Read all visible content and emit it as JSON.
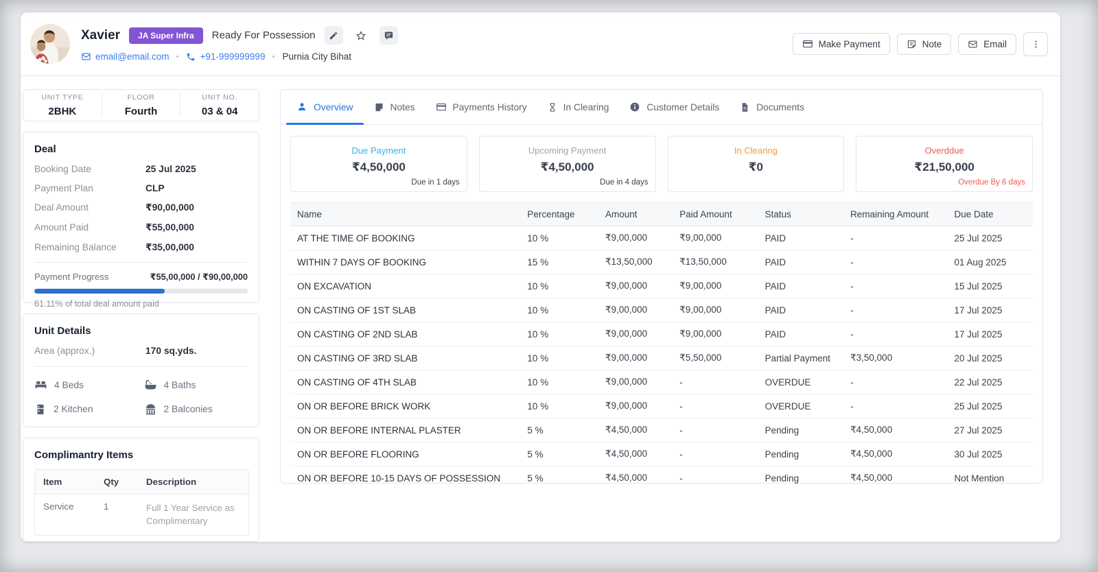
{
  "header": {
    "name": "Xavier",
    "badge": {
      "label": "JA Super Infra",
      "color": "#8254d6"
    },
    "status": "Ready For Possession",
    "action_icons": [
      "pencil-icon",
      "star-icon",
      "chat-icon",
      "kebab-icon"
    ],
    "contact": {
      "email": "email@email.com",
      "phone": "+91-999999999",
      "location": "Purnia City Bihat"
    },
    "buttons": {
      "make_payment": "Make Payment",
      "note": "Note",
      "email": "Email"
    }
  },
  "sidebar": {
    "unit_summary": [
      {
        "label": "UNIT TYPE",
        "value": "2BHK"
      },
      {
        "label": "FLOOR",
        "value": "Fourth"
      },
      {
        "label": "UNIT NO.",
        "value": "03 & 04"
      }
    ],
    "deal": {
      "title": "Deal",
      "rows": [
        {
          "label": "Booking Date",
          "value": "25 Jul 2025"
        },
        {
          "label": "Payment Plan",
          "value": "CLP"
        },
        {
          "label": "Deal Amount",
          "value": "₹90,00,000"
        },
        {
          "label": "Amount Paid",
          "value": "₹55,00,000"
        },
        {
          "label": "Remaining Balance",
          "value": "₹35,00,000"
        }
      ],
      "progress_label": "Payment Progress",
      "progress_value": "₹55,00,000 / ₹90,00,000",
      "progress_pct": 61.11,
      "progress_color": "#2e6fd0",
      "progress_note": "61.11% of total deal amount paid"
    },
    "unit_details": {
      "title": "Unit Details",
      "area_label": "Area (approx.)",
      "area_value": "170 sq.yds.",
      "features": [
        {
          "icon": "bed-icon",
          "label": "4 Beds"
        },
        {
          "icon": "bath-icon",
          "label": "4 Baths"
        },
        {
          "icon": "kitchen-icon",
          "label": "2 Kitchen"
        },
        {
          "icon": "balcony-icon",
          "label": "2 Balconies"
        }
      ]
    },
    "complimentary": {
      "title": "Complimantry Items",
      "headers": [
        "Item",
        "Qty",
        "Description"
      ],
      "rows": [
        {
          "item": "Service",
          "qty": "1",
          "description": "Full 1 Year Service as Complimentary"
        }
      ]
    }
  },
  "main": {
    "tabs": [
      {
        "label": "Overview",
        "icon": "person-icon",
        "active": true
      },
      {
        "label": "Notes",
        "icon": "note-icon",
        "active": false
      },
      {
        "label": "Payments History",
        "icon": "card-icon",
        "active": false
      },
      {
        "label": "In Clearing",
        "icon": "hourglass-icon",
        "active": false
      },
      {
        "label": "Customer Details",
        "icon": "info-icon",
        "active": false
      },
      {
        "label": "Documents",
        "icon": "document-icon",
        "active": false
      }
    ],
    "summary_cards": [
      {
        "title": "Due Payment",
        "amount": "₹4,50,000",
        "note": "Due in 1 days",
        "color": "#33b3e3"
      },
      {
        "title": "Upcoming Payment",
        "amount": "₹4,50,000",
        "note": "Due in 4 days",
        "color": "#9ca3af"
      },
      {
        "title": "In Clearing",
        "amount": "₹0",
        "note": "",
        "color": "#f09a2d"
      },
      {
        "title": "Overddue",
        "amount": "₹21,50,000",
        "note": "Overdue By 6 days",
        "color": "#ec5b52"
      }
    ],
    "table": {
      "headers": [
        "Name",
        "Percentage",
        "Amount",
        "Paid Amount",
        "Status",
        "Remaining Amount",
        "Due Date"
      ],
      "status_colors": {
        "paid": "#27a35a",
        "partial": "#d7a021",
        "overdue": "#e23b36",
        "pending": "#5f6672"
      },
      "rows": [
        {
          "name": "AT THE TIME OF BOOKING",
          "percentage": "10 %",
          "amount": "₹9,00,000",
          "paid": "₹9,00,000",
          "status": "PAID",
          "status_type": "paid",
          "remaining": "-",
          "due": "25 Jul 2025"
        },
        {
          "name": "WITHIN 7 DAYS OF BOOKING",
          "percentage": "15 %",
          "amount": "₹13,50,000",
          "paid": "₹13,50,000",
          "status": "PAID",
          "status_type": "paid",
          "remaining": "-",
          "due": "01 Aug 2025"
        },
        {
          "name": "ON EXCAVATION",
          "percentage": "10 %",
          "amount": "₹9,00,000",
          "paid": "₹9,00,000",
          "status": "PAID",
          "status_type": "paid",
          "remaining": "-",
          "due": "15 Jul 2025"
        },
        {
          "name": "ON CASTING OF 1ST SLAB",
          "percentage": "10 %",
          "amount": "₹9,00,000",
          "paid": "₹9,00,000",
          "status": "PAID",
          "status_type": "paid",
          "remaining": "-",
          "due": "17 Jul 2025"
        },
        {
          "name": "ON CASTING OF 2ND SLAB",
          "percentage": "10 %",
          "amount": "₹9,00,000",
          "paid": "₹9,00,000",
          "status": "PAID",
          "status_type": "paid",
          "remaining": "-",
          "due": "17 Jul 2025"
        },
        {
          "name": "ON CASTING OF 3RD SLAB",
          "percentage": "10 %",
          "amount": "₹9,00,000",
          "paid": "₹5,50,000",
          "status": "Partial Payment",
          "status_type": "partial",
          "remaining": "₹3,50,000",
          "due": "20 Jul 2025"
        },
        {
          "name": "ON CASTING OF 4TH SLAB",
          "percentage": "10 %",
          "amount": "₹9,00,000",
          "paid": "-",
          "status": "OVERDUE",
          "status_type": "overdue",
          "remaining": "-",
          "due": "22 Jul 2025"
        },
        {
          "name": "ON OR BEFORE BRICK WORK",
          "percentage": "10 %",
          "amount": "₹9,00,000",
          "paid": "-",
          "status": "OVERDUE",
          "status_type": "overdue",
          "remaining": "-",
          "due": "25 Jul 2025"
        },
        {
          "name": "ON OR BEFORE INTERNAL PLASTER",
          "percentage": "5 %",
          "amount": "₹4,50,000",
          "paid": "-",
          "status": "Pending",
          "status_type": "pending",
          "remaining": "₹4,50,000",
          "due": "27 Jul 2025"
        },
        {
          "name": "ON OR BEFORE FLOORING",
          "percentage": "5 %",
          "amount": "₹4,50,000",
          "paid": "-",
          "status": "Pending",
          "status_type": "pending",
          "remaining": "₹4,50,000",
          "due": "30 Jul 2025"
        },
        {
          "name": "ON OR BEFORE 10-15 DAYS OF POSSESSION",
          "percentage": "5 %",
          "amount": "₹4,50,000",
          "paid": "-",
          "status": "Pending",
          "status_type": "pending",
          "remaining": "₹4,50,000",
          "due": "Not Mention"
        }
      ]
    }
  }
}
